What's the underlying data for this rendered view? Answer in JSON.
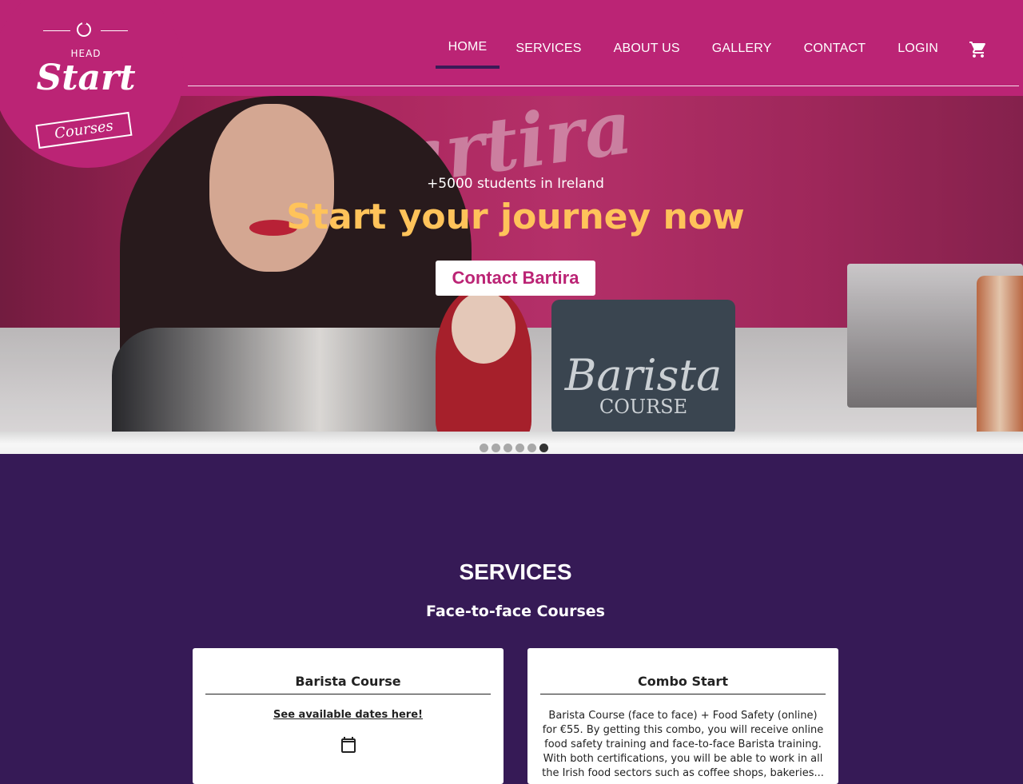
{
  "brand": {
    "logo_head": "HEAD",
    "logo_start": "Start",
    "logo_courses": "Courses"
  },
  "nav": {
    "items": [
      "HOME",
      "SERVICES",
      "ABOUT US",
      "GALLERY",
      "CONTACT",
      "LOGIN"
    ],
    "active": "HOME",
    "cart_icon": "shopping-cart-icon"
  },
  "hero": {
    "subtitle": "+5000 students in Ireland",
    "title": "Start your journey now",
    "cta_label": "Contact Bartira",
    "wall_text": "Bartira",
    "board_text": "Barista",
    "board_sub": "COURSE"
  },
  "carousel": {
    "slide_count": 6,
    "active_index": 6
  },
  "services": {
    "title": "SERVICES",
    "subtitle": "Face-to-face Courses",
    "cards": [
      {
        "title": "Barista Course",
        "link": "See available dates here!",
        "icon": "calendar-icon"
      },
      {
        "title": "Combo Start",
        "text": "Barista Course (face to face) + Food Safety (online) for €55. By getting this combo, you will receive online food safety training and face-to-face Barista training. With both certifications, you will be able to work in all the Irish food sectors such as coffee shops, bakeries..."
      }
    ]
  },
  "colors": {
    "header": "#bb2475",
    "services_bg": "#361a56",
    "accent": "#ffc35a"
  }
}
